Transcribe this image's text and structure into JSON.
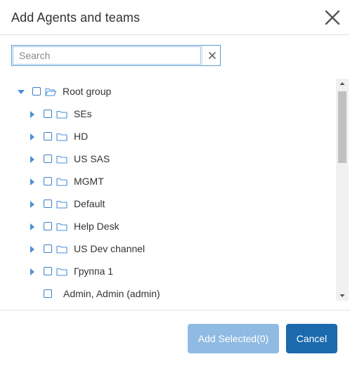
{
  "dialog": {
    "title": "Add Agents and teams",
    "close_icon": "close-icon"
  },
  "search": {
    "placeholder": "Search",
    "value": "",
    "clear_icon": "clear-icon"
  },
  "tree": {
    "root": {
      "label": "Root group",
      "expanded": true,
      "icon": "folder-open-icon"
    },
    "groups": [
      {
        "label": "SEs",
        "icon": "folder-icon"
      },
      {
        "label": "HD",
        "icon": "folder-icon"
      },
      {
        "label": "US SAS",
        "icon": "folder-icon"
      },
      {
        "label": "MGMT",
        "icon": "folder-icon"
      },
      {
        "label": "Default",
        "icon": "folder-icon"
      },
      {
        "label": "Help Desk",
        "icon": "folder-icon"
      },
      {
        "label": "US Dev channel",
        "icon": "folder-icon"
      },
      {
        "label": "Группа 1",
        "icon": "folder-icon"
      }
    ],
    "agents": [
      {
        "label": "Admin, Admin (admin)"
      }
    ]
  },
  "footer": {
    "add_selected_label": "Add Selected(0)",
    "cancel_label": "Cancel"
  },
  "colors": {
    "accent": "#1b6aad",
    "accent_disabled": "#8fbbe3",
    "checkbox_border": "#3d7fc4",
    "expander": "#4a90d9"
  }
}
